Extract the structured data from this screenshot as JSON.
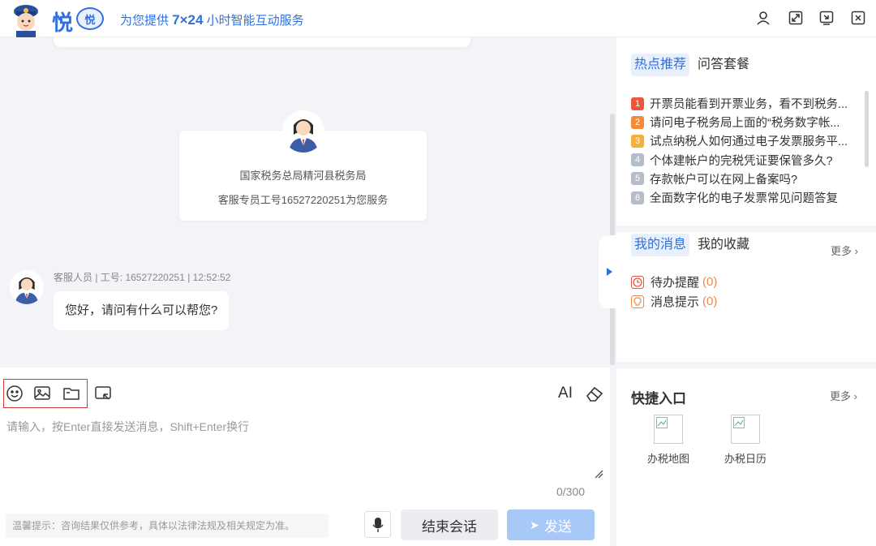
{
  "header": {
    "brand": "悦",
    "badge": "悦",
    "tagline_prefix": "为您提供 ",
    "tagline_bold": "7×24",
    "tagline_suffix": " 小时智能互动服务",
    "icons": [
      "user-icon",
      "fullscreen-icon",
      "export-icon",
      "close-icon"
    ]
  },
  "chat": {
    "intro": {
      "office": "国家税务总局精河县税务局",
      "agent_line": "客服专员工号16527220251为您服务"
    },
    "message": {
      "meta": "客服人员 | 工号: 16527220251 | 12:52:52",
      "text": "您好，请问有什么可以帮您?"
    }
  },
  "input": {
    "placeholder": "请输入，按Enter直接发送消息，Shift+Enter换行",
    "counter": "0/300",
    "tip": "温馨提示：咨询结果仅供参考，具体以法律法规及相关规定为准。",
    "end_label": "结束会话",
    "send_label": "发送",
    "font_label": "AI"
  },
  "sidebar": {
    "tabs": [
      "热点推荐",
      "问答套餐"
    ],
    "hot": [
      {
        "num": "1",
        "text": "开票员能看到开票业务，看不到税务...",
        "color": "#f0553c"
      },
      {
        "num": "2",
        "text": "请问电子税务局上面的“税务数字帐...",
        "color": "#f58a3c"
      },
      {
        "num": "3",
        "text": "试点纳税人如何通过电子发票服务平...",
        "color": "#f5b03c"
      },
      {
        "num": "4",
        "text": "个体建帐户的完税凭证要保管多久?",
        "color": "#b6bcc8"
      },
      {
        "num": "5",
        "text": "存款帐户可以在网上备案吗?",
        "color": "#b6bcc8"
      },
      {
        "num": "6",
        "text": "全面数字化的电子发票常见问题答复",
        "color": "#b6bcc8"
      }
    ],
    "tabs2": [
      "我的消息",
      "我的收藏"
    ],
    "more": "更多",
    "messages": [
      {
        "label": "待办提醒",
        "count": "(0)",
        "icon": "clock-icon",
        "color": "#e8533f"
      },
      {
        "label": "消息提示",
        "count": "(0)",
        "icon": "bulb-icon",
        "color": "#f08a4b"
      }
    ],
    "quick_title": "快捷入口",
    "quick_more": "更多",
    "quick": [
      {
        "label": "办税地图"
      },
      {
        "label": "办税日历"
      }
    ]
  }
}
